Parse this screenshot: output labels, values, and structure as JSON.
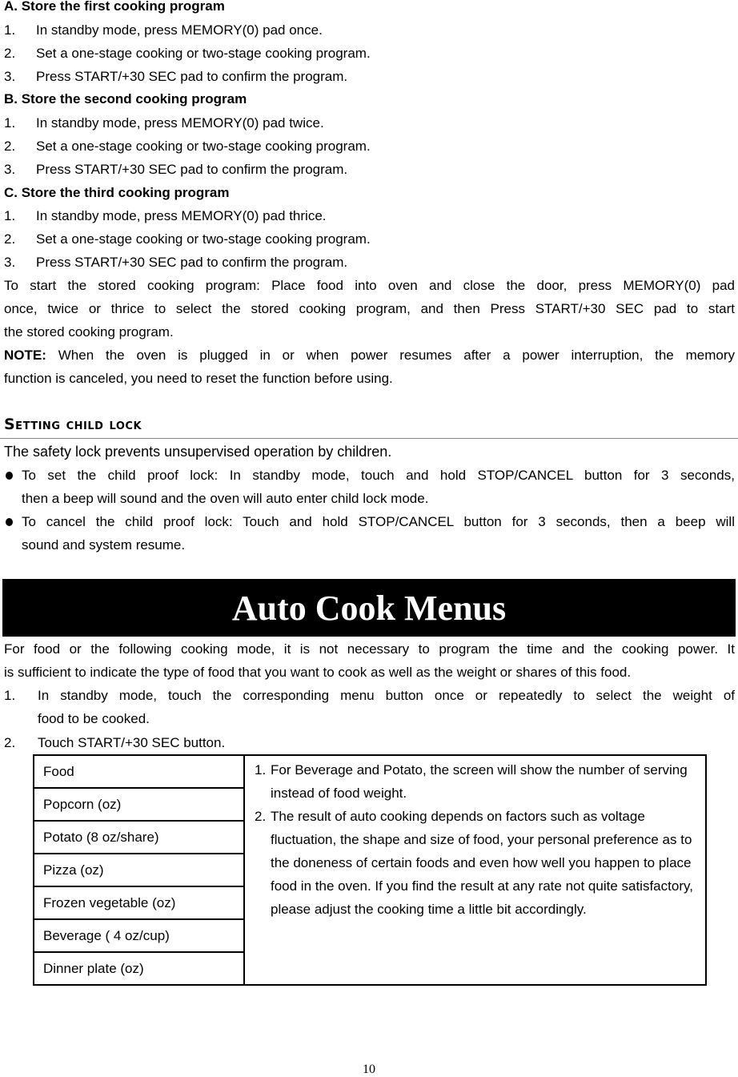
{
  "memory_programs": [
    {
      "heading": "A. Store the first cooking program",
      "steps": [
        {
          "num": "1.",
          "text": "In standby mode, press MEMORY(0) pad once."
        },
        {
          "num": "2.",
          "text": "Set a one-stage cooking or two-stage cooking program."
        },
        {
          "num": "3.",
          "text": "Press START/+30 SEC pad to confirm the program."
        }
      ]
    },
    {
      "heading": "B. Store the second cooking program",
      "steps": [
        {
          "num": "1.",
          "text": "In standby mode, press MEMORY(0) pad twice."
        },
        {
          "num": "2.",
          "text": "Set a one-stage cooking or two-stage cooking program."
        },
        {
          "num": "3.",
          "text": "Press START/+30 SEC pad to confirm the program."
        }
      ]
    },
    {
      "heading": "C. Store the third cooking program",
      "steps": [
        {
          "num": "1.",
          "text": "In standby mode, press MEMORY(0) pad thrice."
        },
        {
          "num": "2.",
          "text": "Set a one-stage cooking or two-stage cooking program."
        },
        {
          "num": "3.",
          "text": "Press START/+30 SEC pad to confirm the program."
        }
      ]
    }
  ],
  "start_stored": {
    "lines": [
      "To start the stored cooking program: Place food into oven and close the door, press MEMORY(0) pad",
      "once, twice or thrice to select the stored cooking program, and then Press START/+30 SEC pad to start",
      "the stored cooking program."
    ]
  },
  "note": {
    "label": "NOTE:",
    "line1": "When the oven is plugged in or when power resumes after a power interruption, the memory",
    "line2": "function is canceled, you need to reset the function before using."
  },
  "child_lock": {
    "heading": "Setting child lock",
    "intro": "The safety lock prevents unsupervised operation by children.",
    "bullets": [
      {
        "line1": "To set the child proof lock: In standby mode, touch and hold STOP/CANCEL button for 3 seconds,",
        "line2": "then a beep will sound and the oven will auto enter child lock mode."
      },
      {
        "line1": "To cancel the child proof lock: Touch and hold STOP/CANCEL button for 3 seconds, then a beep will",
        "line2": "sound and system resume."
      }
    ]
  },
  "auto_cook": {
    "banner": "Auto Cook Menus",
    "intro_lines": [
      "For food or the following cooking mode, it is not necessary to program the time and the cooking power. It",
      "is sufficient to indicate the type of food that you want to cook as well as the weight or shares of this food."
    ],
    "steps": [
      {
        "num": "1.",
        "line1": "In standby mode, touch the corresponding menu button once or repeatedly to select the weight of",
        "line2": "food to be cooked."
      },
      {
        "num": "2.",
        "line1": "Touch START/+30 SEC button.",
        "line2": ""
      }
    ],
    "table": {
      "foods": [
        "Food",
        "Popcorn (oz)",
        "Potato (8 oz/share)",
        "Pizza (oz)",
        "Frozen vegetable (oz)",
        "Beverage ( 4 oz/cup)",
        "Dinner plate (oz)"
      ],
      "notes": [
        {
          "num": "1.",
          "text": "For Beverage and Potato, the screen will show the number of serving instead of food weight."
        },
        {
          "num": "2.",
          "text": "The result of auto cooking depends on factors such as voltage fluctuation, the shape and size of food, your personal preference as to the doneness of certain foods and even how well you happen to place food in the oven. If you find the result at any rate not quite satisfactory, please adjust the cooking time a little bit accordingly."
        }
      ]
    }
  },
  "page_number": "10"
}
